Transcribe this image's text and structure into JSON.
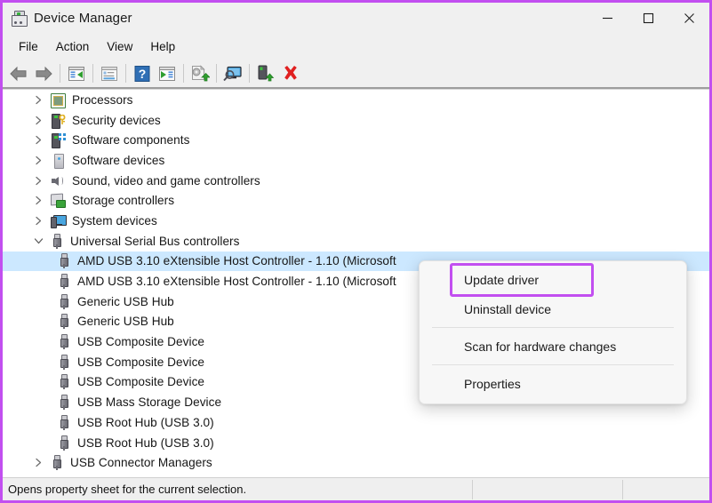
{
  "window": {
    "title": "Device Manager",
    "icon": "device-manager-icon",
    "controls": [
      {
        "name": "minimize-button",
        "glyph": "minimize"
      },
      {
        "name": "maximize-button",
        "glyph": "maximize"
      },
      {
        "name": "close-button",
        "glyph": "close"
      }
    ]
  },
  "menubar": {
    "items": [
      {
        "label": "File"
      },
      {
        "label": "Action"
      },
      {
        "label": "View"
      },
      {
        "label": "Help"
      }
    ]
  },
  "toolbar": {
    "buttons": [
      {
        "name": "back-button",
        "icon": "back-arrow-icon"
      },
      {
        "name": "forward-button",
        "icon": "forward-arrow-icon"
      },
      {
        "name": "separator-1",
        "icon": "separator"
      },
      {
        "name": "show-hide-console-tree-button",
        "icon": "console-tree-icon"
      },
      {
        "name": "separator-2",
        "icon": "separator"
      },
      {
        "name": "properties-button",
        "icon": "properties-window-icon"
      },
      {
        "name": "separator-3",
        "icon": "separator"
      },
      {
        "name": "help-button",
        "icon": "question-mark-help-icon"
      },
      {
        "name": "show-hide-action-pane-button",
        "icon": "action-pane-icon"
      },
      {
        "name": "separator-4",
        "icon": "separator"
      },
      {
        "name": "update-driver-button",
        "icon": "update-driver-icon"
      },
      {
        "name": "separator-5",
        "icon": "separator"
      },
      {
        "name": "scan-for-hardware-changes-button",
        "icon": "scan-hardware-icon"
      },
      {
        "name": "separator-6",
        "icon": "separator"
      },
      {
        "name": "enable-device-button",
        "icon": "enable-device-icon"
      },
      {
        "name": "uninstall-device-button",
        "icon": "red-x-uninstall-icon"
      }
    ]
  },
  "tree": {
    "rows": [
      {
        "label": "Processors",
        "icon": "processor-icon",
        "chevron": "collapsed",
        "indent": 0,
        "selected": false
      },
      {
        "label": "Security devices",
        "icon": "security-device-icon",
        "chevron": "collapsed",
        "indent": 0,
        "selected": false
      },
      {
        "label": "Software components",
        "icon": "software-component-icon",
        "chevron": "collapsed",
        "indent": 0,
        "selected": false
      },
      {
        "label": "Software devices",
        "icon": "software-device-icon",
        "chevron": "collapsed",
        "indent": 0,
        "selected": false
      },
      {
        "label": "Sound, video and game controllers",
        "icon": "sound-device-icon",
        "chevron": "collapsed",
        "indent": 0,
        "selected": false
      },
      {
        "label": "Storage controllers",
        "icon": "storage-controller-icon",
        "chevron": "collapsed",
        "indent": 0,
        "selected": false
      },
      {
        "label": "System devices",
        "icon": "system-device-icon",
        "chevron": "collapsed",
        "indent": 0,
        "selected": false
      },
      {
        "label": "Universal Serial Bus controllers",
        "icon": "usb-icon",
        "chevron": "expanded",
        "indent": 0,
        "selected": false
      },
      {
        "label": "AMD USB 3.10 eXtensible Host Controller - 1.10 (Microsoft",
        "icon": "usb-icon",
        "chevron": "none",
        "indent": 1,
        "selected": true
      },
      {
        "label": "AMD USB 3.10 eXtensible Host Controller - 1.10 (Microsoft",
        "icon": "usb-icon",
        "chevron": "none",
        "indent": 1,
        "selected": false
      },
      {
        "label": "Generic USB Hub",
        "icon": "usb-icon",
        "chevron": "none",
        "indent": 1,
        "selected": false
      },
      {
        "label": "Generic USB Hub",
        "icon": "usb-icon",
        "chevron": "none",
        "indent": 1,
        "selected": false
      },
      {
        "label": "USB Composite Device",
        "icon": "usb-icon",
        "chevron": "none",
        "indent": 1,
        "selected": false
      },
      {
        "label": "USB Composite Device",
        "icon": "usb-icon",
        "chevron": "none",
        "indent": 1,
        "selected": false
      },
      {
        "label": "USB Composite Device",
        "icon": "usb-icon",
        "chevron": "none",
        "indent": 1,
        "selected": false
      },
      {
        "label": "USB Mass Storage Device",
        "icon": "usb-icon",
        "chevron": "none",
        "indent": 1,
        "selected": false
      },
      {
        "label": "USB Root Hub (USB 3.0)",
        "icon": "usb-icon",
        "chevron": "none",
        "indent": 1,
        "selected": false
      },
      {
        "label": "USB Root Hub (USB 3.0)",
        "icon": "usb-icon",
        "chevron": "none",
        "indent": 1,
        "selected": false
      },
      {
        "label": "USB Connector Managers",
        "icon": "usb-icon",
        "chevron": "collapsed",
        "indent": 0,
        "selected": false
      }
    ]
  },
  "context_menu": {
    "items": [
      {
        "label": "Update driver",
        "name": "update-driver-menu-item",
        "highlighted": true,
        "separator_after": false
      },
      {
        "label": "Uninstall device",
        "name": "uninstall-device-menu-item",
        "highlighted": false,
        "separator_after": true
      },
      {
        "label": "Scan for hardware changes",
        "name": "scan-for-hardware-changes-menu-item",
        "highlighted": false,
        "separator_after": true
      },
      {
        "label": "Properties",
        "name": "properties-menu-item",
        "highlighted": false,
        "separator_after": false
      }
    ]
  },
  "statusbar": {
    "text": "Opens property sheet for the current selection."
  },
  "colors": {
    "annotation_highlight": "#c24ff0",
    "selection": "#cce8ff",
    "window_chrome": "#f0f0f0",
    "tree_background": "#ffffff"
  }
}
